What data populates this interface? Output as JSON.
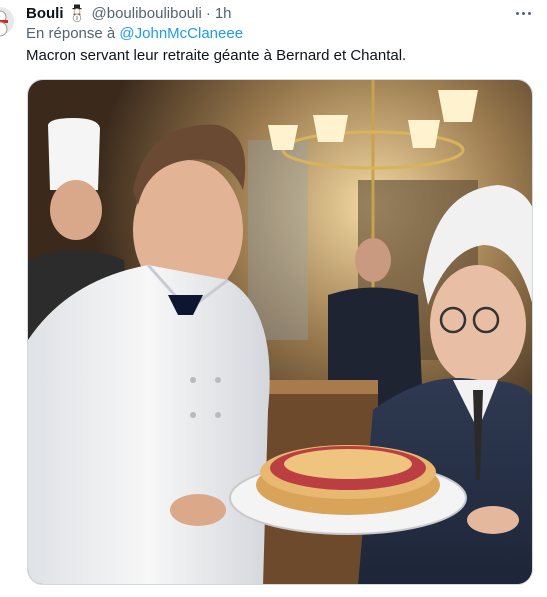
{
  "tweet": {
    "author_name": "Bouli",
    "author_emoji": "snowman-icon",
    "handle": "@bouliboulibouli",
    "separator": "·",
    "time": "1h",
    "more_icon": "more-horizontal-icon",
    "reply_prefix": "En réponse à",
    "reply_to": "@JohnMcClaneee",
    "text": "Macron servant leur retraite géante à Bernard et Chantal.",
    "media_alt_icon": "photo-image"
  },
  "colors": {
    "text_primary": "#0f1419",
    "text_secondary": "#536471",
    "link": "#1d9bf0",
    "border": "#cfd9de"
  }
}
